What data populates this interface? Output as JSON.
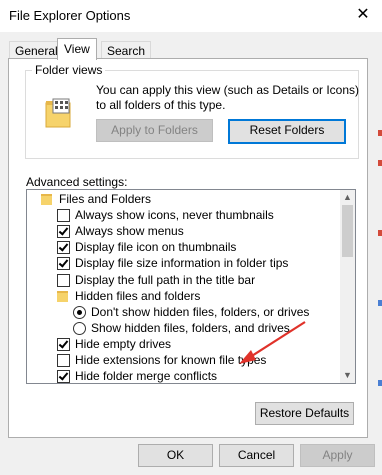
{
  "window": {
    "title": "File Explorer Options",
    "close_glyph": "✕"
  },
  "tabs": [
    {
      "label": "General"
    },
    {
      "label": "View"
    },
    {
      "label": "Search"
    }
  ],
  "folder_views": {
    "group_label": "Folder views",
    "description": "You can apply this view (such as Details or Icons) to all folders of this type.",
    "apply_label": "Apply to Folders",
    "reset_label": "Reset Folders"
  },
  "advanced": {
    "label": "Advanced settings:",
    "items": [
      {
        "type": "folder",
        "label": "Files and Folders",
        "indent": 0
      },
      {
        "type": "checkbox",
        "label": "Always show icons, never thumbnails",
        "checked": false,
        "indent": 1
      },
      {
        "type": "checkbox",
        "label": "Always show menus",
        "checked": true,
        "indent": 1
      },
      {
        "type": "checkbox",
        "label": "Display file icon on thumbnails",
        "checked": true,
        "indent": 1
      },
      {
        "type": "checkbox",
        "label": "Display file size information in folder tips",
        "checked": true,
        "indent": 1
      },
      {
        "type": "checkbox",
        "label": "Display the full path in the title bar",
        "checked": false,
        "indent": 1
      },
      {
        "type": "folder",
        "label": "Hidden files and folders",
        "indent": 1
      },
      {
        "type": "radio",
        "label": "Don't show hidden files, folders, or drives",
        "checked": true,
        "indent": 2
      },
      {
        "type": "radio",
        "label": "Show hidden files, folders, and drives",
        "checked": false,
        "indent": 2
      },
      {
        "type": "checkbox",
        "label": "Hide empty drives",
        "checked": true,
        "indent": 1
      },
      {
        "type": "checkbox",
        "label": "Hide extensions for known file types",
        "checked": false,
        "indent": 1
      },
      {
        "type": "checkbox",
        "label": "Hide folder merge conflicts",
        "checked": true,
        "indent": 1
      }
    ]
  },
  "scrollbar": {
    "up_glyph": "▲",
    "down_glyph": "▼",
    "position_fraction": 0.0
  },
  "buttons": {
    "restore_defaults": "Restore Defaults",
    "ok": "OK",
    "cancel": "Cancel",
    "apply": "Apply"
  },
  "annotation": {
    "arrow_color": "#e0322a"
  },
  "colors": {
    "accent": "#0078d7",
    "folder": "#f6d36b"
  }
}
